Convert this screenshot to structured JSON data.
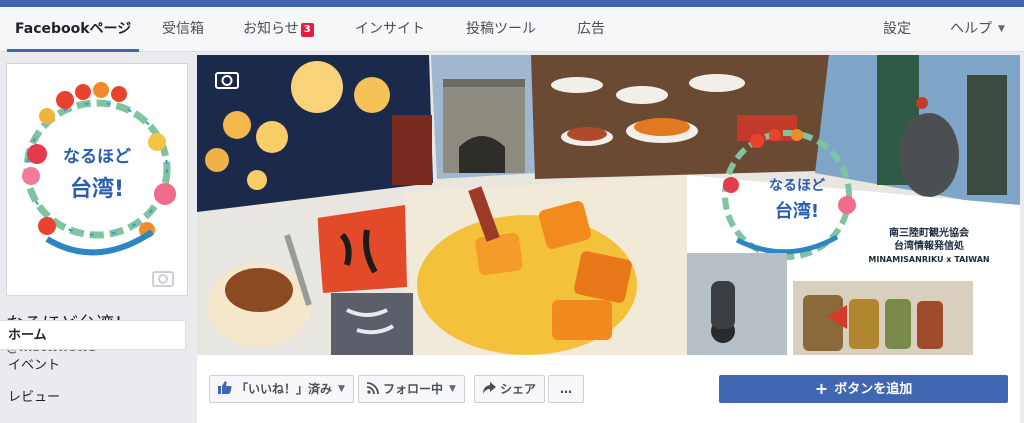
{
  "tabs": [
    {
      "label": "Facebookページ",
      "active": true
    },
    {
      "label": "受信箱"
    },
    {
      "label": "お知らせ",
      "badge": "3"
    },
    {
      "label": "インサイト"
    },
    {
      "label": "投稿ツール"
    },
    {
      "label": "広告"
    }
  ],
  "right_tabs": {
    "settings": "設定",
    "help": "ヘルプ"
  },
  "page": {
    "name": "なるほど台湾！",
    "handle": "@mstwnews",
    "logo_text_line1": "なるほど",
    "logo_text_line2": "台湾!"
  },
  "nav": [
    "ホーム",
    "イベント",
    "レビュー"
  ],
  "cover": {
    "org_line1": "南三陸町観光協会",
    "org_line2": "台湾情報発信処",
    "org_line3": "MINAMISANRIKU x TAIWAN",
    "logo_line1": "なるほど",
    "logo_line2": "台湾!"
  },
  "actions": {
    "like": "「いいね！」済み",
    "follow": "フォロー中",
    "share": "シェア",
    "more": "…",
    "add_button": "ボタンを追加"
  },
  "colors": {
    "brand": "#4267b2",
    "badge": "#e41e3f",
    "background": "#e9ebee"
  }
}
